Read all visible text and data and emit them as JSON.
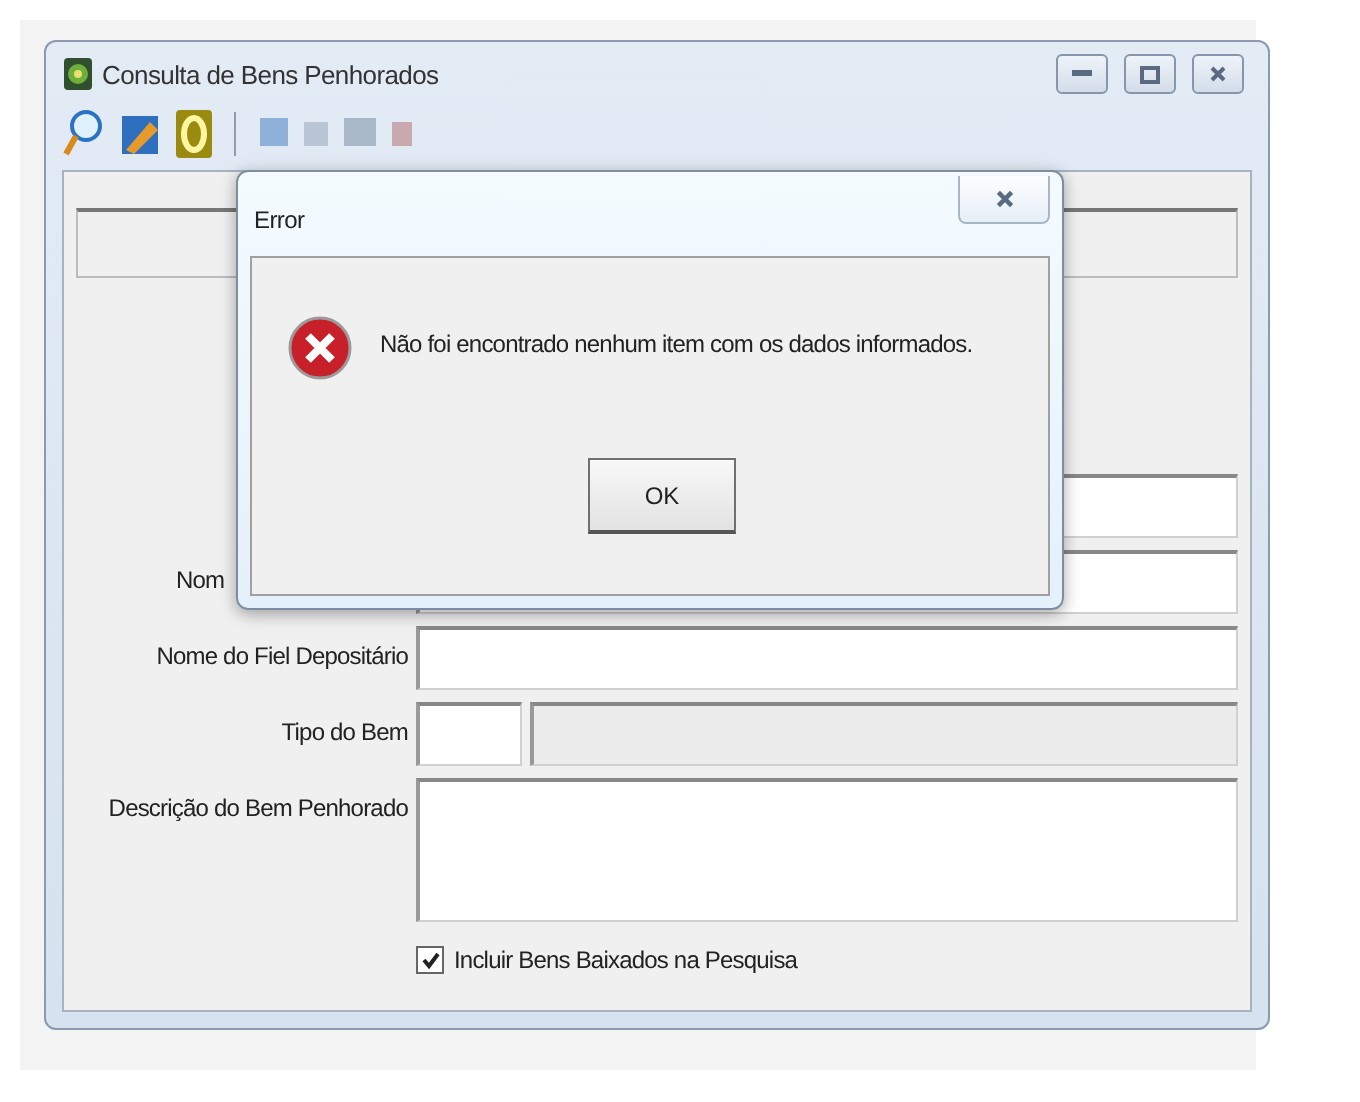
{
  "window": {
    "title": "Consulta de Bens Penhorados"
  },
  "form": {
    "rows": [
      {
        "kind": "text"
      },
      {
        "kind": "text",
        "label": "Nom",
        "truncated": true
      },
      {
        "kind": "text",
        "label": "Nome do Fiel Depositário"
      },
      {
        "kind": "code",
        "label": "Tipo do Bem"
      },
      {
        "kind": "memo",
        "label": "Descrição do Bem Penhorado"
      }
    ],
    "checkbox": {
      "label": "Incluir Bens Baixados na Pesquisa",
      "checked": true
    }
  },
  "dialog": {
    "title": "Error",
    "message": "Não foi encontrado nenhum item com os dados informados.",
    "button": "OK"
  }
}
